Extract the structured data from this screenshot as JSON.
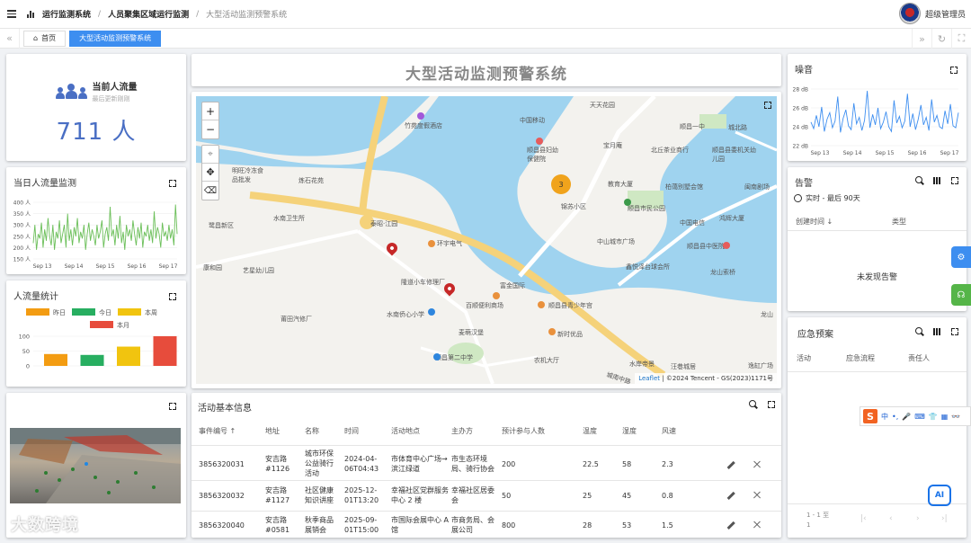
{
  "breadcrumb": {
    "level1": "运行监测系统",
    "level2": "人员聚集区域运行监测",
    "level3": "大型活动监测预警系统"
  },
  "user": {
    "name": "超级管理员"
  },
  "tabs": [
    {
      "label": "首页",
      "icon": "home-icon",
      "active": false
    },
    {
      "label": "大型活动监测预警系统",
      "active": true
    }
  ],
  "current_flow": {
    "label": "当前人流量",
    "sub": "最后更新刚刚",
    "value": "711 人",
    "icon": "people-icon",
    "color": "#4a6fc4"
  },
  "daily_monitor": {
    "title": "当日人流量监测",
    "chart_data": {
      "type": "line",
      "x_ticks": [
        "Sep 13",
        "Sep 14",
        "Sep 15",
        "Sep 16",
        "Sep 17"
      ],
      "y_ticks": [
        "400 人",
        "350 人",
        "300 人",
        "250 人",
        "200 人",
        "150 人"
      ],
      "ylim": [
        150,
        400
      ],
      "color": "#6bbf59",
      "values": [
        220,
        300,
        190,
        260,
        240,
        310,
        200,
        280,
        230,
        330,
        250,
        210,
        300,
        190,
        270,
        240,
        320,
        220,
        260,
        300,
        200,
        350,
        230,
        280,
        210,
        290,
        250,
        330,
        220,
        270,
        240,
        300,
        190,
        260,
        310,
        230,
        280,
        250,
        210,
        300,
        240,
        270,
        320,
        200,
        260,
        290,
        230,
        380,
        250,
        280,
        210,
        300,
        240,
        340,
        220,
        270,
        190,
        300,
        250,
        280,
        230,
        320,
        260,
        210,
        290,
        240,
        310,
        200,
        270,
        250,
        300,
        230,
        280,
        220,
        360,
        240,
        290,
        260,
        200,
        310,
        250,
        270,
        230,
        300,
        240,
        280,
        210,
        390,
        260
      ]
    }
  },
  "flow_stats": {
    "title": "人流量统计",
    "chart_data": {
      "type": "bar",
      "categories": [
        "昨日",
        "今日",
        "本周",
        "本月"
      ],
      "values": [
        40,
        37,
        65,
        100
      ],
      "colors": [
        "#f39c12",
        "#27ae60",
        "#f1c40f",
        "#e74c3c"
      ],
      "ylim": [
        0,
        100
      ],
      "y_ticks": [
        "100",
        "50",
        "0"
      ]
    }
  },
  "main_title": "大型活动监测预警系统",
  "map": {
    "cluster_count": "3",
    "attribution_leaflet": "Leaflet",
    "attribution_rest": "| ©2024 Tencent - GS(2023)1171号",
    "zoom_in": "+",
    "zoom_out": "−",
    "labels": [
      "竹苑度假酒店",
      "天天花园",
      "中国移动",
      "顺昌一中",
      "顺昌县妇幼保健院",
      "宝月庵",
      "北丘茶业商行",
      "顺昌县委机关幼儿园",
      "教育大厦",
      "柏蔼别墅会馆",
      "锦苏小区",
      "顺昌市民公园",
      "鸿辉大厦",
      "中国电信",
      "闽南剧场",
      "中山城市广场",
      "顺昌县中医院",
      "鑫悦泽台球会所",
      "龙山索桥",
      "明旺冷冻食品批发",
      "炼石花苑",
      "水南卫生所",
      "鹭昌新区",
      "泰昭·江园",
      "环宇电气",
      "康和园",
      "艺星幼儿园",
      "隆道小车修理厂",
      "富金国际",
      "百顺便利商场",
      "水南侨心小学",
      "顺昌县青少年宫",
      "莆田汽修厂",
      "麦萌汉堡",
      "新时优品",
      "顺昌第二中学",
      "农机大厅",
      "水岸帝景",
      "汪巷城居",
      "逸缸广场",
      "城南中路",
      "城北路",
      "龙山"
    ]
  },
  "activity_table": {
    "title": "活动基本信息",
    "headers": [
      "事件编号",
      "地址",
      "名称",
      "时间",
      "活动地点",
      "主办方",
      "预计参与人数",
      "温度",
      "湿度",
      "风速"
    ],
    "sort_indicator": "↑",
    "rows": [
      {
        "id": "3856320031",
        "address": "安吉路 #1126",
        "name": "城市环保公益骑行活动",
        "time": "2024-04-06T04:43",
        "place": "市体育中心广场→滨江绿道",
        "host": "市生态环境局、骑行协会",
        "people": "200",
        "temp": "22.5",
        "humidity": "58",
        "wind": "2.3"
      },
      {
        "id": "3856320032",
        "address": "安吉路 #1127",
        "name": "社区健康知识讲座",
        "time": "2025-12-01T13:20",
        "place": "幸福社区党群服务中心 2 楼",
        "host": "幸福社区居委会",
        "people": "50",
        "temp": "25",
        "humidity": "45",
        "wind": "0.8"
      },
      {
        "id": "3856320040",
        "address": "安吉路 #0581",
        "name": "秋季商品展销会",
        "time": "2025-09-01T15:00",
        "place": "市国际会展中心 A 馆",
        "host": "市商务局、会展公司",
        "people": "800",
        "temp": "28",
        "humidity": "53",
        "wind": "1.5"
      }
    ]
  },
  "noise": {
    "title": "噪音",
    "chart_data": {
      "type": "line",
      "x_ticks": [
        "Sep 13",
        "Sep 14",
        "Sep 15",
        "Sep 16",
        "Sep 17"
      ],
      "y_ticks": [
        "28 dB",
        "26 dB",
        "24 dB",
        "22 dB"
      ],
      "ylim": [
        22,
        28
      ],
      "color": "#3d8ef0",
      "values": [
        24.5,
        23.8,
        25.2,
        24.0,
        26.1,
        23.5,
        24.8,
        25.5,
        23.9,
        24.6,
        27.2,
        23.4,
        24.9,
        25.8,
        24.1,
        23.7,
        26.5,
        24.3,
        25.0,
        23.6,
        24.7,
        27.8,
        23.9,
        25.3,
        24.2,
        26.0,
        23.8,
        24.5,
        25.6,
        24.0,
        23.5,
        26.8,
        24.4,
        25.1,
        23.9,
        24.6,
        27.5,
        24.0,
        25.4,
        23.7,
        24.8,
        26.3,
        24.2,
        25.0,
        23.6,
        26.9,
        24.5,
        25.2,
        24.0,
        23.8,
        25.7,
        24.3,
        26.4,
        24.1,
        23.9,
        25.5
      ]
    }
  },
  "alarm": {
    "title": "告警",
    "range_label": "实时 - 最后 90天",
    "col_created": "创建时间",
    "col_type": "类型",
    "empty": "未发现告警"
  },
  "emergency": {
    "title": "应急预案",
    "headers": [
      "活动",
      "应急流程",
      "责任人"
    ],
    "pager_text": "1 - 1 至",
    "pager_page": "1"
  },
  "ime": {
    "brand": "S",
    "items": [
      "中",
      "•,",
      "🎤",
      "⌨",
      "👕",
      "▦",
      "👓"
    ]
  },
  "watermark": "大数跨境",
  "colors": {
    "accent": "#3d8ef0",
    "primary_blue": "#4a6fc4",
    "danger": "#c62828",
    "green_btn": "#55b548"
  }
}
